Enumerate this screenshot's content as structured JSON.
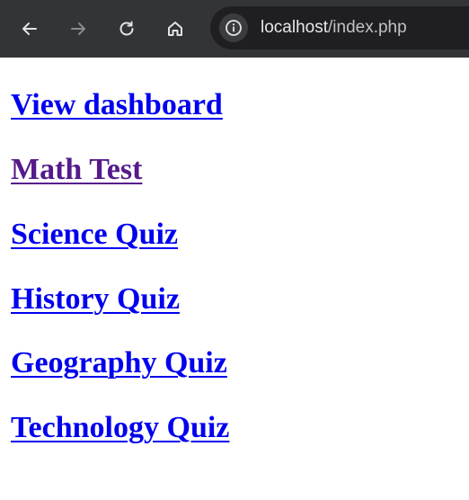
{
  "browser": {
    "url_host": "localhost",
    "url_path": "/index.php",
    "icons": {
      "back": "arrow-left-icon",
      "forward": "arrow-right-icon",
      "reload": "reload-icon",
      "home": "home-icon",
      "site_info": "info-icon"
    },
    "colors": {
      "toolbar": "#333438",
      "omnibox": "#1f1f23"
    }
  },
  "page": {
    "links": [
      {
        "label": "View dashboard",
        "visited": false
      },
      {
        "label": "Math Test",
        "visited": true
      },
      {
        "label": "Science Quiz",
        "visited": false
      },
      {
        "label": "History Quiz",
        "visited": false
      },
      {
        "label": "Geography Quiz",
        "visited": false
      },
      {
        "label": "Technology Quiz",
        "visited": false
      }
    ],
    "colors": {
      "link": "#0000ee",
      "visited_link": "#551a8b"
    }
  }
}
